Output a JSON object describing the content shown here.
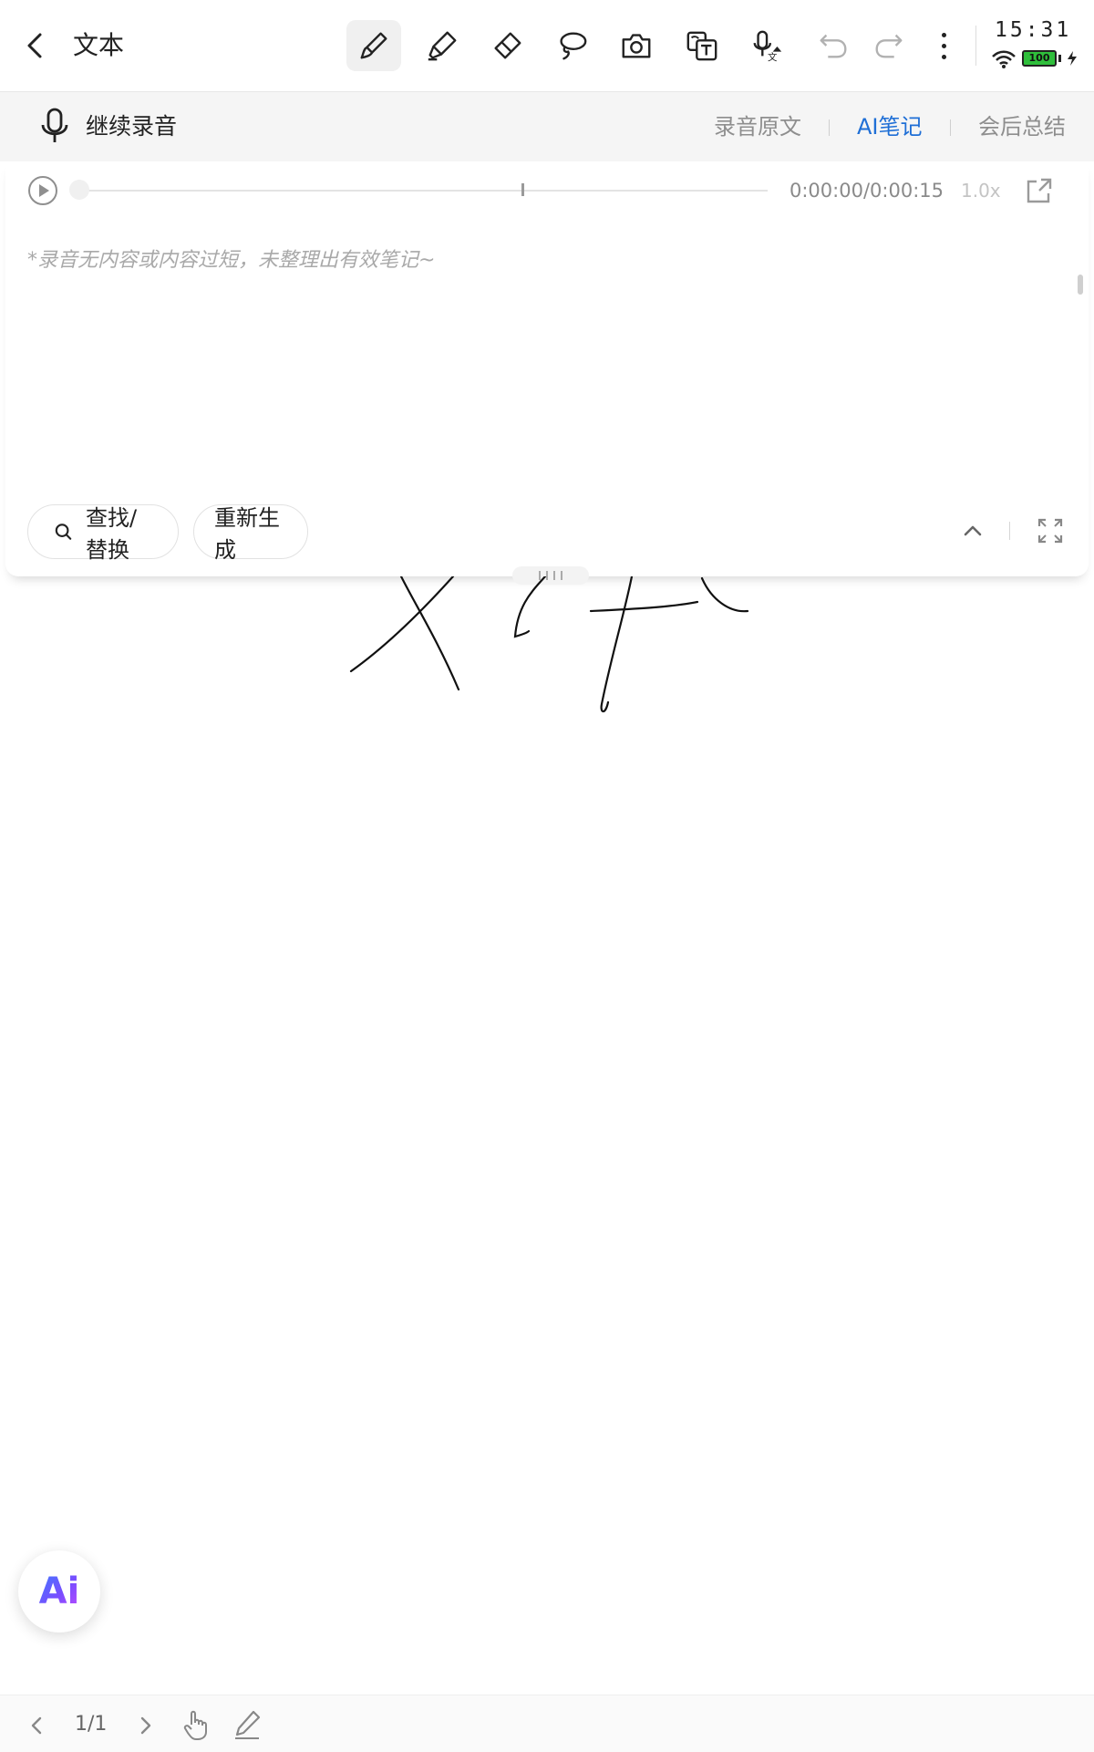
{
  "header": {
    "title": "文本",
    "tools": [
      "brush-icon",
      "marker-icon",
      "eraser-icon",
      "lasso-icon",
      "camera-icon",
      "text-convert-icon",
      "mic-translate-icon",
      "undo-icon",
      "redo-icon"
    ],
    "active_tool": "brush-icon"
  },
  "status": {
    "time": "15:31",
    "battery": "100"
  },
  "recording": {
    "continue_label": "继续录音",
    "tabs": [
      {
        "label": "录音原文",
        "active": false
      },
      {
        "label": "AI笔记",
        "active": true
      },
      {
        "label": "会后总结",
        "active": false
      }
    ]
  },
  "player": {
    "time": "0:00:00/0:00:15",
    "speed": "1.0x"
  },
  "ai_notes": {
    "empty_message": "*录音无内容或内容过短，未整理出有效笔记~"
  },
  "actions": {
    "find_replace": "查找/替换",
    "regenerate": "重新生成"
  },
  "ai_fab": {
    "label": "Ai"
  },
  "pager": {
    "page": "1/1"
  },
  "colors": {
    "accent": "#1f6fd6",
    "battery": "#2fbe3b"
  }
}
